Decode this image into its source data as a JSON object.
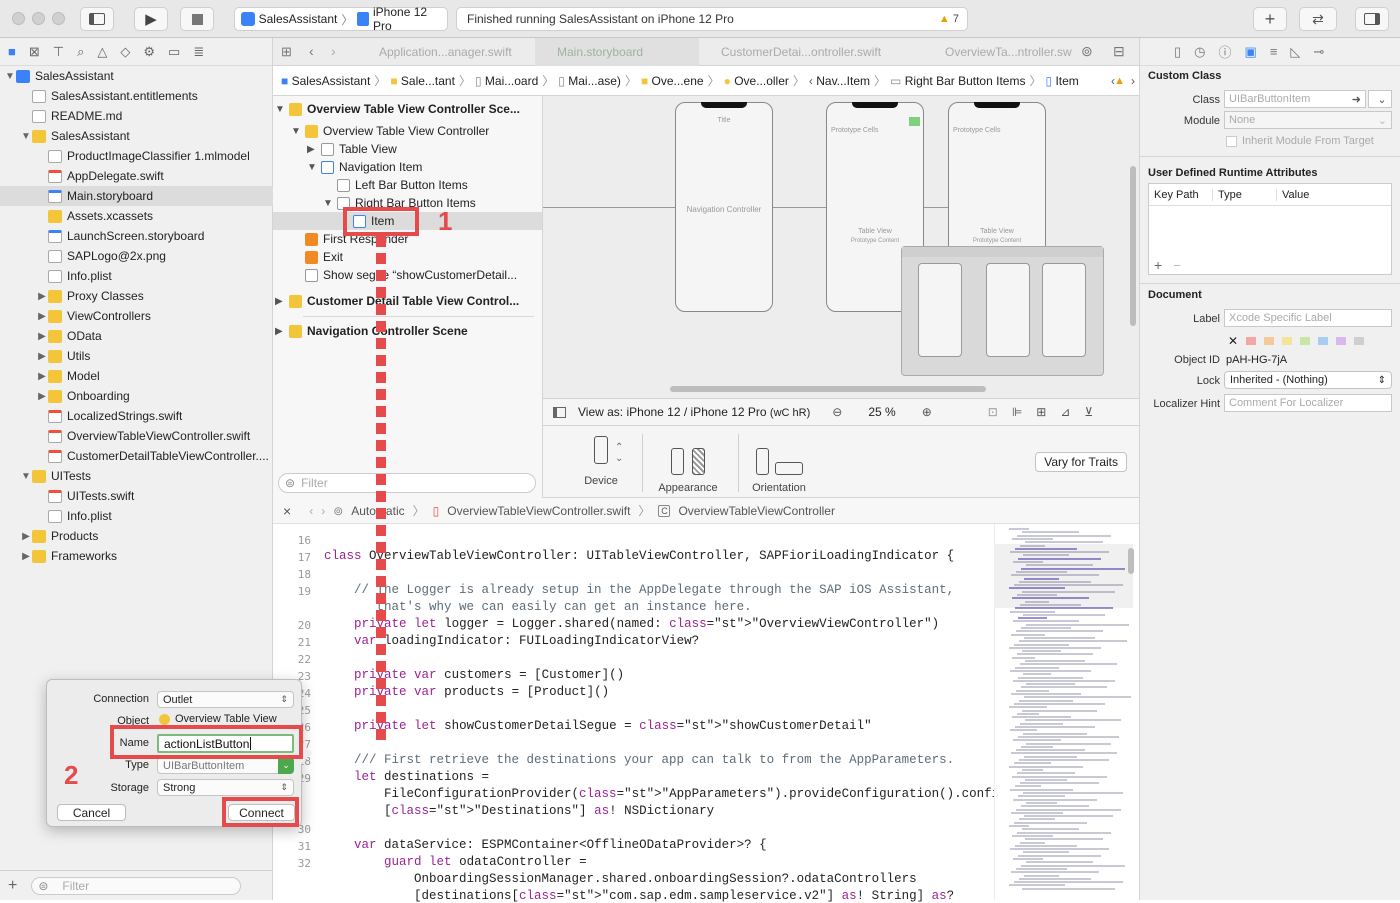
{
  "toolbar": {
    "scheme": "SalesAssistant",
    "device": "iPhone 12 Pro",
    "status": "Finished running SalesAssistant on iPhone 12 Pro",
    "warnings": "7"
  },
  "navigator": {
    "items": [
      {
        "label": "SalesAssistant",
        "icon": "project-icon",
        "level": 0,
        "disc": "▼"
      },
      {
        "label": "SalesAssistant.entitlements",
        "icon": "file-icon",
        "level": 1
      },
      {
        "label": "README.md",
        "icon": "file-icon",
        "level": 1
      },
      {
        "label": "SalesAssistant",
        "icon": "folder-icon",
        "level": 1,
        "disc": "▼"
      },
      {
        "label": "ProductImageClassifier 1.mlmodel",
        "icon": "file-icon",
        "level": 2
      },
      {
        "label": "AppDelegate.swift",
        "icon": "swift-icon",
        "level": 2
      },
      {
        "label": "Main.storyboard",
        "icon": "storyboard-icon",
        "level": 2,
        "selected": true
      },
      {
        "label": "Assets.xcassets",
        "icon": "folder-icon",
        "level": 2
      },
      {
        "label": "LaunchScreen.storyboard",
        "icon": "storyboard-icon",
        "level": 2
      },
      {
        "label": "SAPLogo@2x.png",
        "icon": "file-icon",
        "level": 2
      },
      {
        "label": "Info.plist",
        "icon": "file-icon",
        "level": 2
      },
      {
        "label": "Proxy Classes",
        "icon": "folder-icon",
        "level": 2,
        "disc": "▶"
      },
      {
        "label": "ViewControllers",
        "icon": "folder-icon",
        "level": 2,
        "disc": "▶"
      },
      {
        "label": "OData",
        "icon": "folder-icon",
        "level": 2,
        "disc": "▶"
      },
      {
        "label": "Utils",
        "icon": "folder-icon",
        "level": 2,
        "disc": "▶"
      },
      {
        "label": "Model",
        "icon": "folder-icon",
        "level": 2,
        "disc": "▶"
      },
      {
        "label": "Onboarding",
        "icon": "folder-icon",
        "level": 2,
        "disc": "▶"
      },
      {
        "label": "LocalizedStrings.swift",
        "icon": "swift-icon",
        "level": 2
      },
      {
        "label": "OverviewTableViewController.swift",
        "icon": "swift-icon",
        "level": 2
      },
      {
        "label": "CustomerDetailTableViewController....",
        "icon": "swift-icon",
        "level": 2
      },
      {
        "label": "UITests",
        "icon": "folder-icon",
        "level": 1,
        "disc": "▼"
      },
      {
        "label": "UITests.swift",
        "icon": "swift-icon",
        "level": 2
      },
      {
        "label": "Info.plist",
        "icon": "file-icon",
        "level": 2
      },
      {
        "label": "Products",
        "icon": "folder-icon",
        "level": 1,
        "disc": "▶"
      },
      {
        "label": "Frameworks",
        "icon": "folder-icon",
        "level": 1,
        "disc": "▶"
      }
    ],
    "filter_placeholder": "Filter"
  },
  "tabs": [
    "Application...anager.swift",
    "Main.storyboard",
    "CustomerDetai...ontroller.swift",
    "OverviewTa...ntroller.sw"
  ],
  "jumpbar": [
    "SalesAssistant",
    "Sale...tant",
    "Mai...oard",
    "Mai...ase)",
    "Ove...ene",
    "Ove...oller",
    "Nav...Item",
    "Right Bar Button Items",
    "Item"
  ],
  "outline": {
    "items": [
      {
        "label": "Overview Table View Controller Sce...",
        "icon": "y",
        "x": 12,
        "bold": true,
        "disc": "▼"
      },
      {
        "label": "Overview Table View Controller",
        "icon": "y",
        "x": 28,
        "disc": "▼"
      },
      {
        "label": "Table View",
        "icon": "g",
        "x": 44,
        "disc": "▶"
      },
      {
        "label": "Navigation Item",
        "icon": "b",
        "x": 44,
        "disc": "▼"
      },
      {
        "label": "Left Bar Button Items",
        "icon": "g",
        "x": 60
      },
      {
        "label": "Right Bar Button Items",
        "icon": "g",
        "x": 60,
        "disc": "▼"
      },
      {
        "label": "Item",
        "icon": "b",
        "x": 76
      },
      {
        "label": "First Responder",
        "icon": "o",
        "x": 28
      },
      {
        "label": "Exit",
        "icon": "o",
        "x": 28
      },
      {
        "label": "Show segue “showCustomerDetail...",
        "icon": "g",
        "x": 28
      },
      {
        "label": "Customer Detail Table View Control...",
        "icon": "y",
        "x": 12,
        "bold": true,
        "disc": "▶"
      },
      {
        "label": "Navigation Controller Scene",
        "icon": "y",
        "x": 12,
        "bold": true,
        "disc": "▶"
      }
    ],
    "filter_placeholder": "Filter"
  },
  "canvas": {
    "nav_controller": "Navigation Controller",
    "table_view": "Table View",
    "prototype_content": "Prototype Content",
    "prototype_cells": "Prototype Cells",
    "title": "Title"
  },
  "viewas": {
    "label": "View as: iPhone 12 / iPhone 12 Pro",
    "traits": "(wC hR)",
    "zoom": "25 %"
  },
  "devicebar": {
    "device": "Device",
    "appearance": "Appearance",
    "orientation": "Orientation",
    "vary": "Vary for Traits"
  },
  "codeheader": {
    "mode": "Automatic",
    "file": "OverviewTableViewController.swift",
    "class": "OverviewTableViewController"
  },
  "code": {
    "lines": [
      {
        "n": "16",
        "t": ""
      },
      {
        "n": "17",
        "t": "class OverviewTableViewController: UITableViewController, SAPFioriLoadingIndicator {"
      },
      {
        "n": "18",
        "t": ""
      },
      {
        "n": "19",
        "t": "    // The Logger is already setup in the AppDelegate through the SAP iOS Assistant,"
      },
      {
        "n": "",
        "t": "       that's why we can easily can get an instance here."
      },
      {
        "n": "20",
        "t": "    private let logger = Logger.shared(named: \"OverviewViewController\")"
      },
      {
        "n": "21",
        "t": "    var loadingIndicator: FUILoadingIndicatorView?"
      },
      {
        "n": "22",
        "t": ""
      },
      {
        "n": "23",
        "t": "    private var customers = [Customer]()"
      },
      {
        "n": "24",
        "t": "    private var products = [Product]()"
      },
      {
        "n": "25",
        "t": ""
      },
      {
        "n": "26",
        "t": "    private let showCustomerDetailSegue = \"showCustomerDetail\""
      },
      {
        "n": "27",
        "t": ""
      },
      {
        "n": "28",
        "t": "    /// First retrieve the destinations your app can talk to from the AppParameters."
      },
      {
        "n": "29",
        "t": "    let destinations ="
      },
      {
        "n": "",
        "t": "        FileConfigurationProvider(\"AppParameters\").provideConfiguration().configuration"
      },
      {
        "n": "",
        "t": "        [\"Destinations\"] as! NSDictionary"
      },
      {
        "n": "30",
        "t": ""
      },
      {
        "n": "31",
        "t": "    var dataService: ESPMContainer<OfflineODataProvider>? {"
      },
      {
        "n": "32",
        "t": "        guard let odataController ="
      },
      {
        "n": "",
        "t": "            OnboardingSessionManager.shared.onboardingSession?.odataControllers"
      },
      {
        "n": "",
        "t": "            [destinations[\"com.sap.edm.sampleservice.v2\"] as! String] as?"
      }
    ]
  },
  "popup": {
    "connection_label": "Connection",
    "connection_value": "Outlet",
    "object_label": "Object",
    "object_value": "Overview Table View",
    "name_label": "Name",
    "name_value": "actionListButton",
    "type_label": "Type",
    "type_value": "UIBarButtonItem",
    "storage_label": "Storage",
    "storage_value": "Strong",
    "cancel": "Cancel",
    "connect": "Connect"
  },
  "annotations": {
    "step1": "1",
    "step2": "2",
    "color": "#e54b4b"
  },
  "inspector": {
    "custom_class": "Custom Class",
    "class_label": "Class",
    "class_placeholder": "UIBarButtonItem",
    "module_label": "Module",
    "module_placeholder": "None",
    "inherit": "Inherit Module From Target",
    "runtime_attrs": "User Defined Runtime Attributes",
    "cols": [
      "Key Path",
      "Type",
      "Value"
    ],
    "document": "Document",
    "label_label": "Label",
    "label_placeholder": "Xcode Specific Label",
    "objectid_label": "Object ID",
    "objectid_value": "pAH-HG-7jA",
    "lock_label": "Lock",
    "lock_value": "Inherited - (Nothing)",
    "hint_label": "Localizer Hint",
    "hint_placeholder": "Comment For Localizer"
  }
}
